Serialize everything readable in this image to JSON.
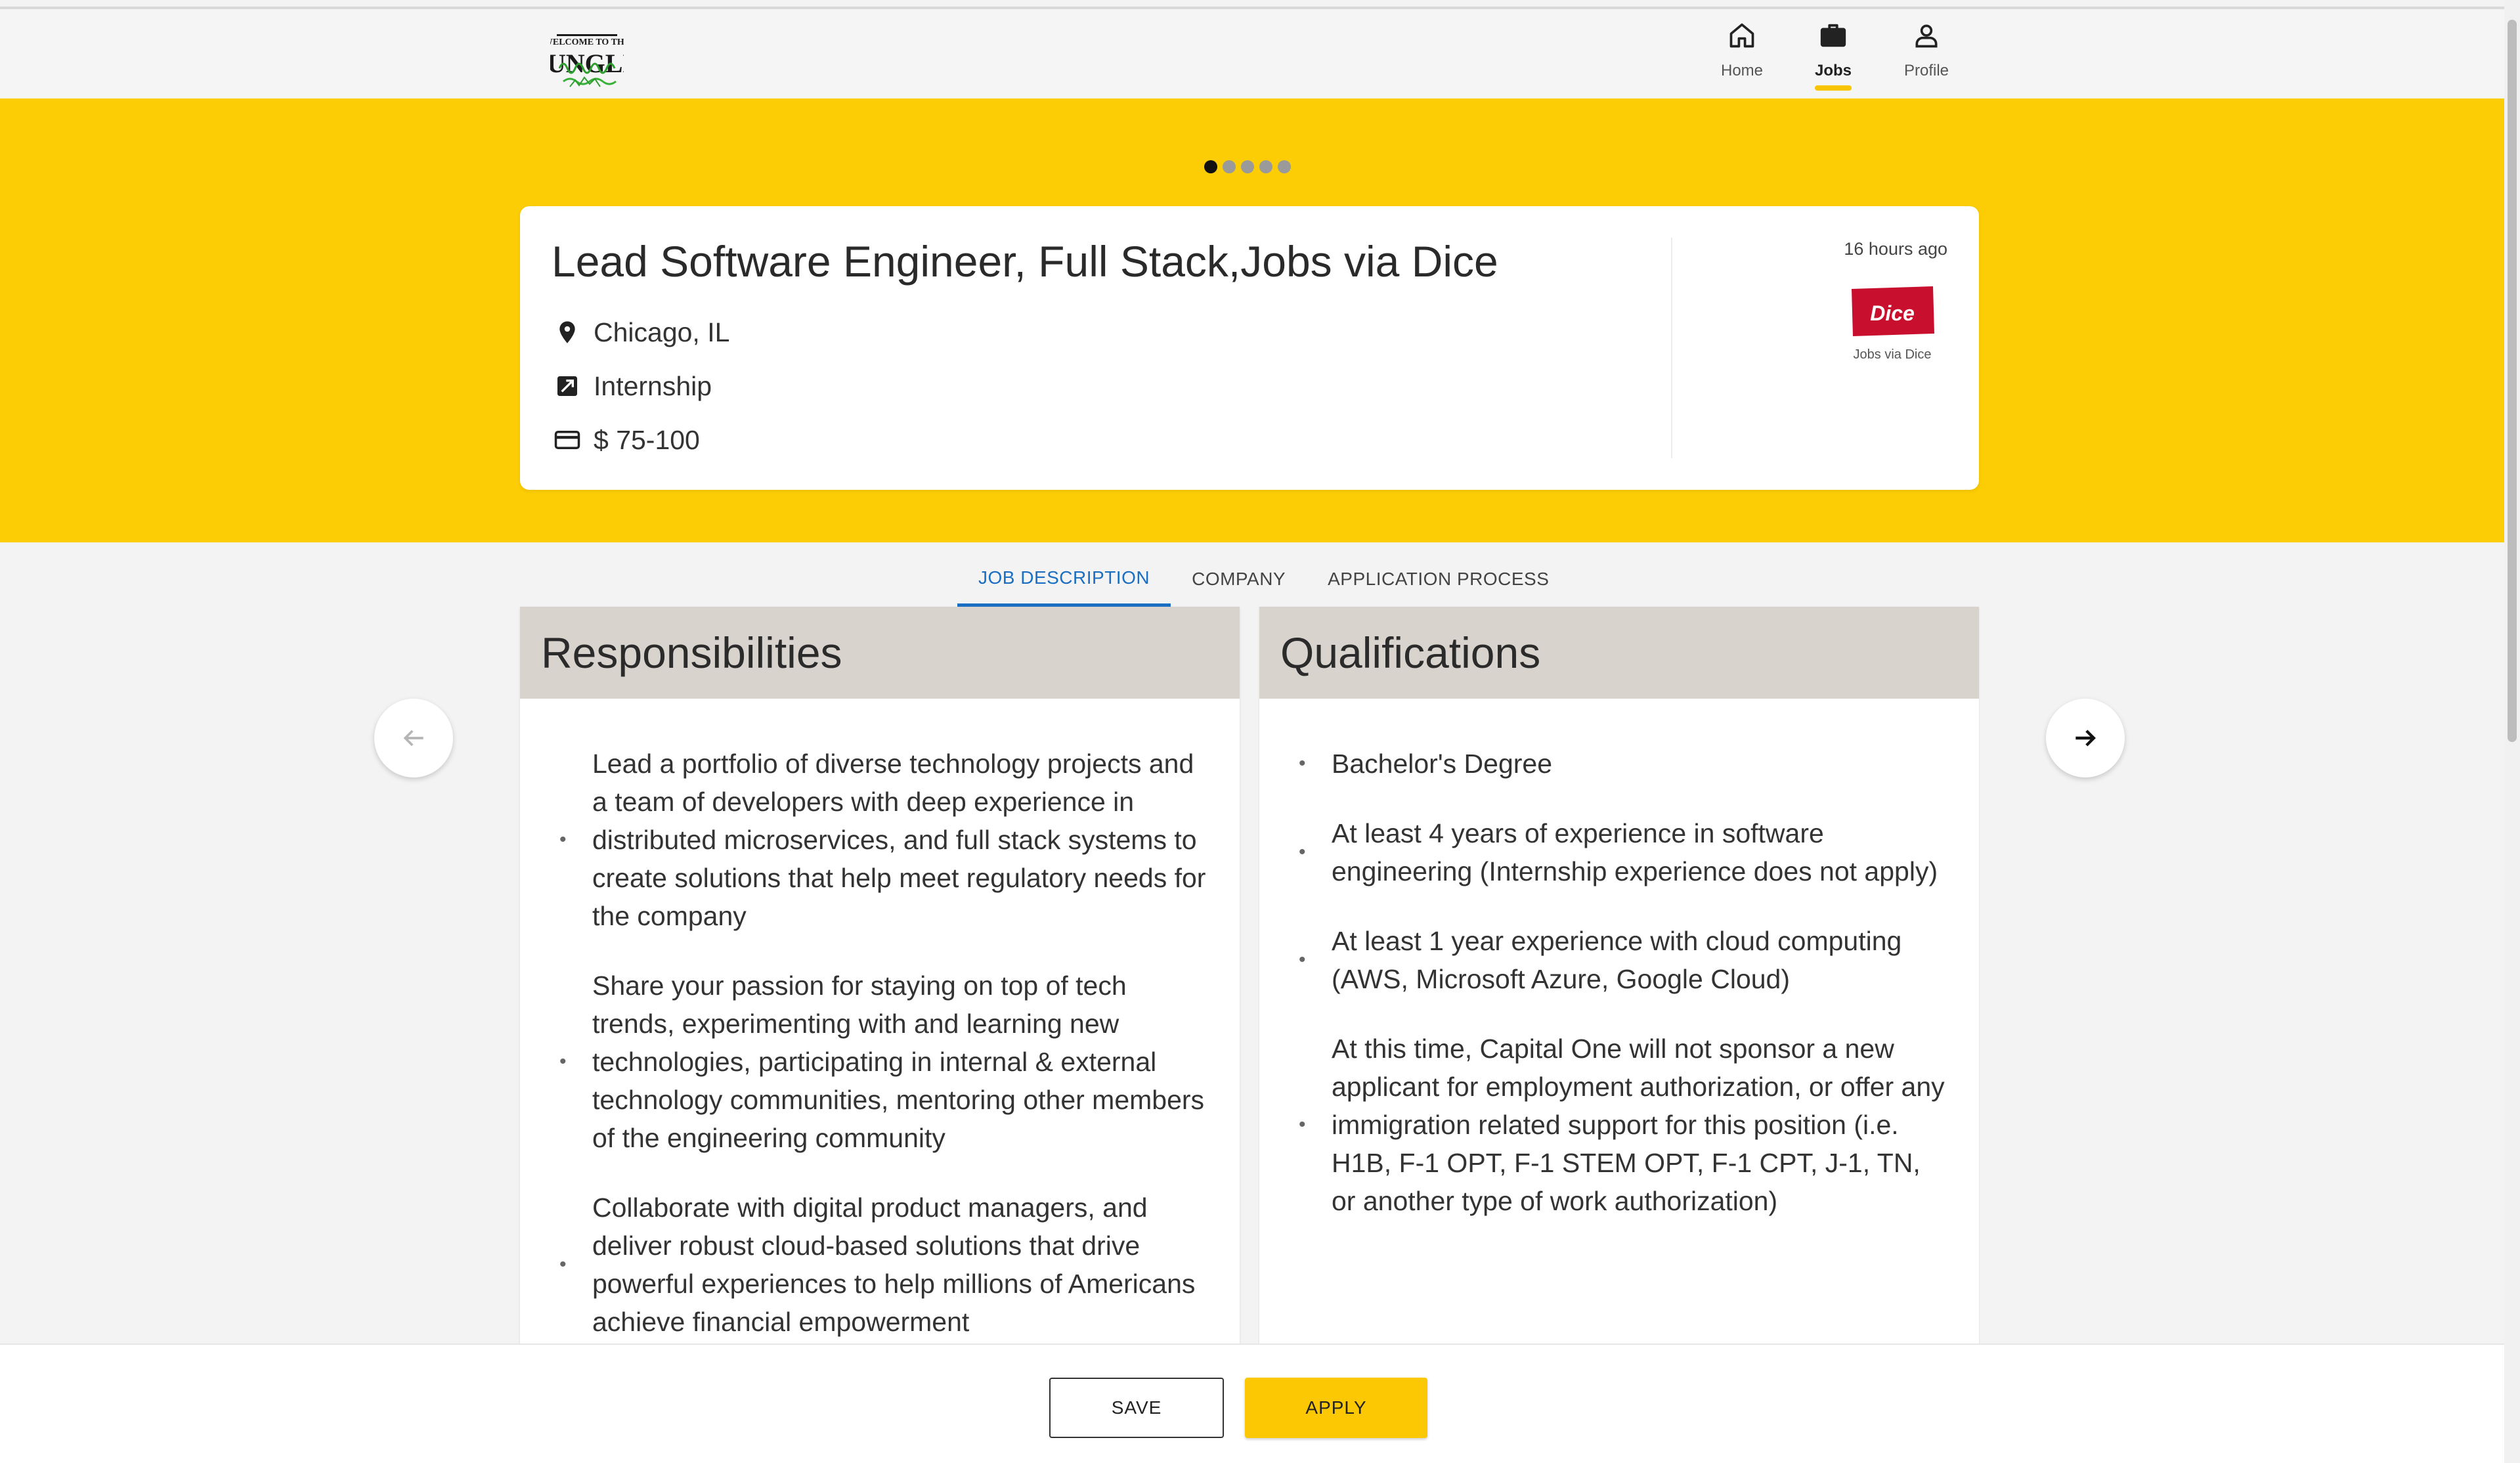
{
  "header": {
    "logo_text_line1": "WELCOME TO THE",
    "logo_text_line2": "JUNGLE",
    "nav": [
      {
        "label": "Home",
        "icon": "home-icon",
        "active": false
      },
      {
        "label": "Jobs",
        "icon": "briefcase-icon",
        "active": true
      },
      {
        "label": "Profile",
        "icon": "person-icon",
        "active": false
      }
    ]
  },
  "carousel": {
    "dot_count": 5,
    "active_index": 0
  },
  "job": {
    "title": "Lead Software Engineer, Full Stack,Jobs via Dice",
    "location": "Chicago, IL",
    "type": "Internship",
    "pay": "$ 75-100",
    "posted": "16 hours ago",
    "company_logo_text": "Dice",
    "company_caption": "Jobs via Dice"
  },
  "tabs": [
    {
      "label": "JOB DESCRIPTION",
      "active": true
    },
    {
      "label": "COMPANY",
      "active": false
    },
    {
      "label": "APPLICATION PROCESS",
      "active": false
    }
  ],
  "responsibilities": {
    "title": "Responsibilities",
    "items": [
      "Lead a portfolio of diverse technology projects and a team of developers with deep experience in distributed microservices, and full stack systems to create solutions that help meet regulatory needs for the company",
      "Share your passion for staying on top of tech trends, experimenting with and learning new technologies, participating in internal & external technology communities, mentoring other members of the engineering community",
      "Collaborate with digital product managers, and deliver robust cloud-based solutions that drive powerful experiences to help millions of Americans achieve financial empowerment"
    ]
  },
  "qualifications": {
    "title": "Qualifications",
    "items": [
      "Bachelor's Degree",
      "At least 4 years of experience in software engineering (Internship experience does not apply)",
      "At least 1 year experience with cloud computing (AWS, Microsoft Azure, Google Cloud)",
      "At this time, Capital One will not sponsor a new applicant for employment authorization, or offer any immigration related support for this position (i.e. H1B, F-1 OPT, F-1 STEM OPT, F-1 CPT, J-1, TN, or another type of work authorization)"
    ]
  },
  "actions": {
    "save_label": "SAVE",
    "apply_label": "APPLY"
  },
  "colors": {
    "banner": "#fccd04",
    "accent_blue": "#1a6fc2",
    "apply_button": "#fcc803",
    "panel_header": "#d9d3ce"
  }
}
